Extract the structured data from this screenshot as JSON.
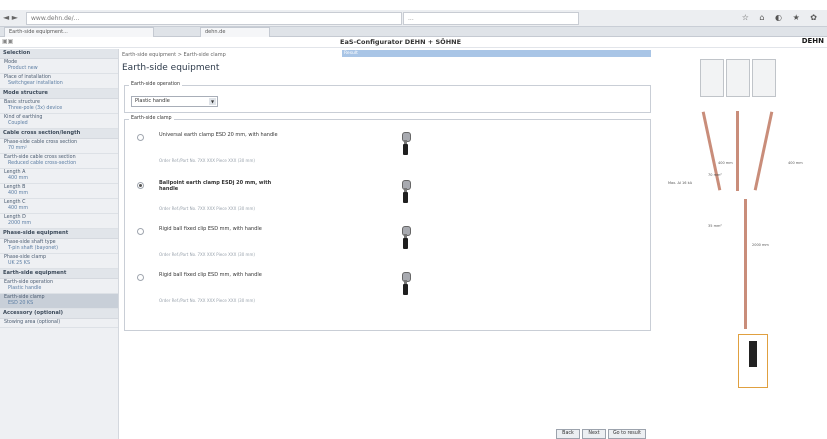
{
  "browser": {
    "url": "www.dehn.de/...",
    "search": "...",
    "tab_label": "Earth-side equipment...",
    "tab2_label": "dehn.de"
  },
  "app": {
    "title": "EaS-Configurator DEHN + SÖHNE",
    "logo": "DEHN"
  },
  "sidebar": {
    "sections": [
      {
        "head": "Selection"
      },
      {
        "label": "Mode",
        "value": "Product new"
      },
      {
        "label": "Place of installation",
        "value": "Switchgear installation"
      },
      {
        "head": "Mode structure"
      },
      {
        "label": "Basic structure",
        "value": "Three-pole (3x) device"
      },
      {
        "label": "Kind of earthing",
        "value": "Coupled"
      },
      {
        "head": "Cable cross section/length"
      },
      {
        "label": "Phase-side cable cross section",
        "value": "70 mm²"
      },
      {
        "label": "Earth-side cable cross section",
        "value": "Reduced cable cross-section"
      },
      {
        "label": "Length A",
        "value": "400 mm"
      },
      {
        "label": "Length B",
        "value": "400 mm"
      },
      {
        "label": "Length C",
        "value": "400 mm"
      },
      {
        "label": "Length D",
        "value": "2000 mm"
      },
      {
        "head": "Phase-side equipment"
      },
      {
        "label": "Phase-side shaft type",
        "value": "T-pin shaft (bayonet)"
      },
      {
        "label": "Phase-side clamp",
        "value": "UK 25 KS"
      },
      {
        "head": "Earth-side equipment"
      },
      {
        "label": "Earth-side operation",
        "value": "Plastic handle"
      },
      {
        "label": "Earth-side clamp",
        "value": "ESD 20 KS",
        "active": true
      },
      {
        "head": "Accessory (optional)"
      },
      {
        "label": "Stowing area (optional)",
        "value": ""
      }
    ]
  },
  "main": {
    "breadcrumb": "Earth-side equipment > Earth-side clamp",
    "step": "Result",
    "title": "Earth-side equipment",
    "operation_box": {
      "title": "Earth-side operation",
      "selected": "Plastic handle"
    },
    "clamp_box": {
      "title": "Earth-side clamp",
      "options": [
        {
          "title": "Universal earth clamp ESD 20 mm, with handle",
          "meta": "Order Ref./Part No. 7XX XXX\nPiece XXX (30 mm)",
          "selected": false
        },
        {
          "title": "Ballpoint earth clamp ESDj 20 mm, with handle",
          "meta": "Order Ref./Part No. 7XX XXX\nPiece XXX (30 mm)",
          "selected": true
        },
        {
          "title": "Rigid ball fixed clip ESD mm, with handle",
          "meta": "Order Ref./Part No. 7XX XXX\nPiece XXX (30 mm)",
          "selected": false
        },
        {
          "title": "Rigid ball fixed clip ESD mm, with handle",
          "meta": "Order Ref./Part No. 7XX XXX\nPiece XXX (30 mm)",
          "selected": false
        }
      ]
    },
    "buttons": [
      "Back",
      "Next",
      "Go to result"
    ]
  },
  "diagram": {
    "labels": [
      "400 mm",
      "400 mm",
      "70 mm²",
      "Max. ΔI 16 kA",
      "35 mm²",
      "2000 mm"
    ]
  }
}
